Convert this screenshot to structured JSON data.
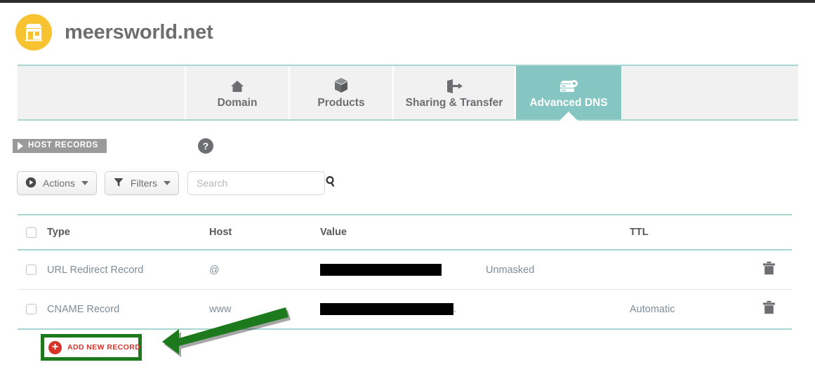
{
  "brand": {
    "name": "meersworld.net",
    "logo_icon": "storefront-icon",
    "logo_color": "#f7c331"
  },
  "tabs": {
    "items": [
      {
        "label": "Domain",
        "icon": "house-icon",
        "active": false
      },
      {
        "label": "Products",
        "icon": "box-icon",
        "active": false
      },
      {
        "label": "Sharing & Transfer",
        "icon": "share-arrow-icon",
        "active": false
      },
      {
        "label": "Advanced DNS",
        "icon": "server-icon",
        "active": true
      }
    ],
    "active_color": "#85c5c2",
    "border_color": "#a6d5d2"
  },
  "section": {
    "title": "HOST RECORDS",
    "help_label": "?",
    "ribbon_color": "#9a9a9a"
  },
  "toolbar": {
    "actions_label": "Actions",
    "actions_icon": "play-circle-icon",
    "filters_label": "Filters",
    "filters_icon": "funnel-icon",
    "search_placeholder": "Search",
    "search_value": "",
    "search_icon": "search-icon"
  },
  "table": {
    "columns": [
      "Type",
      "Host",
      "Value",
      "TTL"
    ],
    "rows": [
      {
        "type": "URL Redirect Record",
        "host": "@",
        "value": "[redacted]",
        "value_extra": "Unmasked",
        "ttl": "",
        "delete_icon": "trash-icon"
      },
      {
        "type": "CNAME Record",
        "host": "www",
        "value": "[redacted]",
        "value_suffix": ".",
        "value_extra": "",
        "ttl": "Automatic",
        "delete_icon": "trash-icon"
      }
    ]
  },
  "add_record": {
    "label": "ADD NEW RECORD",
    "icon": "plus-circle-icon",
    "accent_color": "#d7342a",
    "highlight_color": "#1c7a1c"
  },
  "annotation": {
    "arrow_color": "#1c7a1c",
    "arrow_target": "add-new-record-button"
  }
}
